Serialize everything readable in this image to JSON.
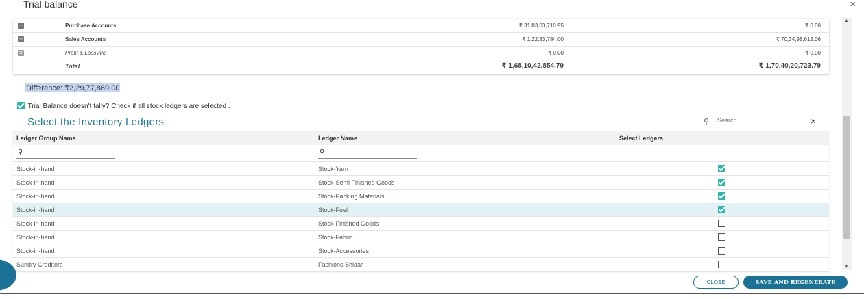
{
  "modal": {
    "title": "Trial balance",
    "close_glyph": "×"
  },
  "trial_balance": {
    "rows": [
      {
        "name": "Purchase Accounts",
        "debit": "₹ 31,83,03,710.95",
        "credit": "₹ 0.00",
        "icon": "expand-icon"
      },
      {
        "name": "Sales Accounts",
        "debit": "₹ 1,22,33,784.00",
        "credit": "₹ 70,34,98,612.06",
        "icon": "expand-icon"
      },
      {
        "name": "Profit & Loss A/c",
        "debit": "₹ 0.00",
        "credit": "₹ 0.00",
        "icon": "document-icon"
      }
    ],
    "total": {
      "label": "Total",
      "debit": "₹ 1,68,10,42,854.79",
      "credit": "₹ 1,70,40,20,723.79"
    }
  },
  "difference": "Difference: ₹2,29,77,869.00",
  "tally_notice": "Trial Balance doesn't tally? Check if all stock ledgers are selected .",
  "inventory": {
    "title": "Select the Inventory Ledgers",
    "search_placeholder": "Search",
    "columns": {
      "group": "Ledger Group Name",
      "ledger": "Ledger Name",
      "select": "Select Ledgers"
    },
    "rows": [
      {
        "group": "Stock-in-hand",
        "ledger": "Stock-Yarn",
        "selected": true
      },
      {
        "group": "Stock-in-hand",
        "ledger": "Stock-Semi Finished Goods",
        "selected": true
      },
      {
        "group": "Stock-in-hand",
        "ledger": "Stock-Packing Materials",
        "selected": true
      },
      {
        "group": "Stock-in-hand",
        "ledger": "Stock-Fuel",
        "selected": true
      },
      {
        "group": "Stock-in-hand",
        "ledger": "Stock-Finished Goods",
        "selected": false
      },
      {
        "group": "Stock-in-hand",
        "ledger": "Stock-Fabric",
        "selected": false
      },
      {
        "group": "Stock-in-hand",
        "ledger": "Stock-Accessories",
        "selected": false
      },
      {
        "group": "Sundry Creditors",
        "ledger": "Fashions Shidar",
        "selected": false
      }
    ]
  },
  "buttons": {
    "close": "CLOSE",
    "save": "SAVE AND REGENERATE"
  },
  "colors": {
    "accent": "#1a7296",
    "check": "#2bb6ae",
    "highlight": "#e2f1f4"
  }
}
